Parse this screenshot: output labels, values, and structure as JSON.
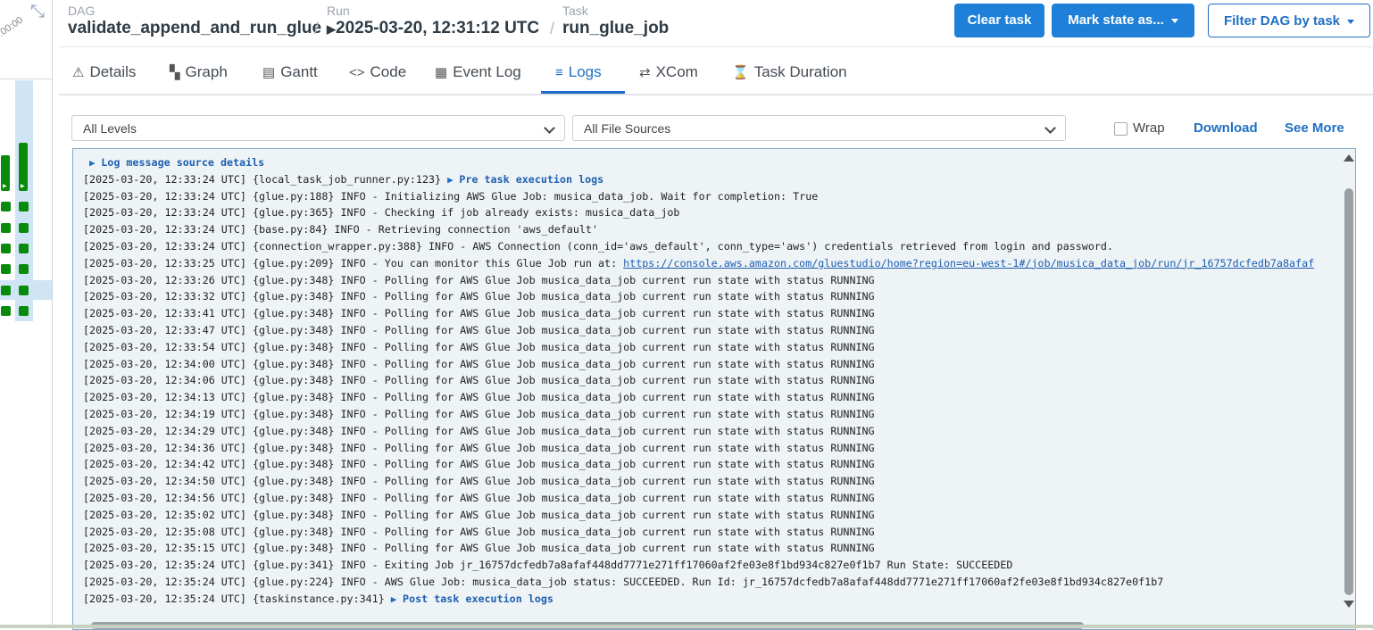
{
  "left_panel": {
    "time_label": ":00:00"
  },
  "breadcrumb": {
    "dag_label": "DAG",
    "dag_value": "validate_append_and_run_glue",
    "run_label": "Run",
    "run_value": "2025-03-20, 12:31:12 UTC",
    "task_label": "Task",
    "task_value": "run_glue_job",
    "separator": "/"
  },
  "actions": {
    "clear_task": "Clear task",
    "mark_state": "Mark state as...",
    "filter_dag": "Filter DAG by task"
  },
  "tabs": [
    {
      "label": "Details",
      "icon": "warning-triangle-icon"
    },
    {
      "label": "Graph",
      "icon": "graph-icon"
    },
    {
      "label": "Gantt",
      "icon": "gantt-icon"
    },
    {
      "label": "Code",
      "icon": "code-icon"
    },
    {
      "label": "Event Log",
      "icon": "calendar-icon"
    },
    {
      "label": "Logs",
      "icon": "list-icon",
      "active": true
    },
    {
      "label": "XCom",
      "icon": "arrows-icon"
    },
    {
      "label": "Task Duration",
      "icon": "hourglass-icon"
    }
  ],
  "filters": {
    "level": "All Levels",
    "source": "All File Sources",
    "wrap_label": "Wrap",
    "wrap_checked": false,
    "download": "Download",
    "see_more": "See More"
  },
  "log": {
    "group_source": "Log message source details",
    "lines": [
      {
        "pre": "[2025-03-20, 12:33:24 UTC] {local_task_job_runner.py:123} ",
        "group": "Pre task execution logs"
      },
      {
        "text": "[2025-03-20, 12:33:24 UTC] {glue.py:188} INFO - Initializing AWS Glue Job: musica_data_job. Wait for completion: True"
      },
      {
        "text": "[2025-03-20, 12:33:24 UTC] {glue.py:365} INFO - Checking if job already exists: musica_data_job"
      },
      {
        "text": "[2025-03-20, 12:33:24 UTC] {base.py:84} INFO - Retrieving connection 'aws_default'"
      },
      {
        "text": "[2025-03-20, 12:33:24 UTC] {connection_wrapper.py:388} INFO - AWS Connection (conn_id='aws_default', conn_type='aws') credentials retrieved from login and password."
      },
      {
        "pre": "[2025-03-20, 12:33:25 UTC] {glue.py:209} INFO - You can monitor this Glue Job run at: ",
        "link": "https://console.aws.amazon.com/gluestudio/home?region=eu-west-1#/job/musica_data_job/run/jr_16757dcfedb7a8afaf"
      },
      {
        "text": "[2025-03-20, 12:33:26 UTC] {glue.py:348} INFO - Polling for AWS Glue Job musica_data_job current run state with status RUNNING"
      },
      {
        "text": "[2025-03-20, 12:33:32 UTC] {glue.py:348} INFO - Polling for AWS Glue Job musica_data_job current run state with status RUNNING"
      },
      {
        "text": "[2025-03-20, 12:33:41 UTC] {glue.py:348} INFO - Polling for AWS Glue Job musica_data_job current run state with status RUNNING"
      },
      {
        "text": "[2025-03-20, 12:33:47 UTC] {glue.py:348} INFO - Polling for AWS Glue Job musica_data_job current run state with status RUNNING"
      },
      {
        "text": "[2025-03-20, 12:33:54 UTC] {glue.py:348} INFO - Polling for AWS Glue Job musica_data_job current run state with status RUNNING"
      },
      {
        "text": "[2025-03-20, 12:34:00 UTC] {glue.py:348} INFO - Polling for AWS Glue Job musica_data_job current run state with status RUNNING"
      },
      {
        "text": "[2025-03-20, 12:34:06 UTC] {glue.py:348} INFO - Polling for AWS Glue Job musica_data_job current run state with status RUNNING"
      },
      {
        "text": "[2025-03-20, 12:34:13 UTC] {glue.py:348} INFO - Polling for AWS Glue Job musica_data_job current run state with status RUNNING"
      },
      {
        "text": "[2025-03-20, 12:34:19 UTC] {glue.py:348} INFO - Polling for AWS Glue Job musica_data_job current run state with status RUNNING"
      },
      {
        "text": "[2025-03-20, 12:34:29 UTC] {glue.py:348} INFO - Polling for AWS Glue Job musica_data_job current run state with status RUNNING"
      },
      {
        "text": "[2025-03-20, 12:34:36 UTC] {glue.py:348} INFO - Polling for AWS Glue Job musica_data_job current run state with status RUNNING"
      },
      {
        "text": "[2025-03-20, 12:34:42 UTC] {glue.py:348} INFO - Polling for AWS Glue Job musica_data_job current run state with status RUNNING"
      },
      {
        "text": "[2025-03-20, 12:34:50 UTC] {glue.py:348} INFO - Polling for AWS Glue Job musica_data_job current run state with status RUNNING"
      },
      {
        "text": "[2025-03-20, 12:34:56 UTC] {glue.py:348} INFO - Polling for AWS Glue Job musica_data_job current run state with status RUNNING"
      },
      {
        "text": "[2025-03-20, 12:35:02 UTC] {glue.py:348} INFO - Polling for AWS Glue Job musica_data_job current run state with status RUNNING"
      },
      {
        "text": "[2025-03-20, 12:35:08 UTC] {glue.py:348} INFO - Polling for AWS Glue Job musica_data_job current run state with status RUNNING"
      },
      {
        "text": "[2025-03-20, 12:35:15 UTC] {glue.py:348} INFO - Polling for AWS Glue Job musica_data_job current run state with status RUNNING"
      },
      {
        "text": "[2025-03-20, 12:35:24 UTC] {glue.py:341} INFO - Exiting Job jr_16757dcfedb7a8afaf448dd7771e271ff17060af2fe03e8f1bd934c827e0f1b7 Run State: SUCCEEDED"
      },
      {
        "text": "[2025-03-20, 12:35:24 UTC] {glue.py:224} INFO - AWS Glue Job: musica_data_job status: SUCCEEDED. Run Id: jr_16757dcfedb7a8afaf448dd7771e271ff17060af2fe03e8f1bd934c827e0f1b7"
      },
      {
        "pre": "[2025-03-20, 12:35:24 UTC] {taskinstance.py:341} ",
        "group": "Post task execution logs"
      }
    ]
  },
  "colors": {
    "accent": "#1e80d9",
    "success": "#0a8a0a"
  }
}
